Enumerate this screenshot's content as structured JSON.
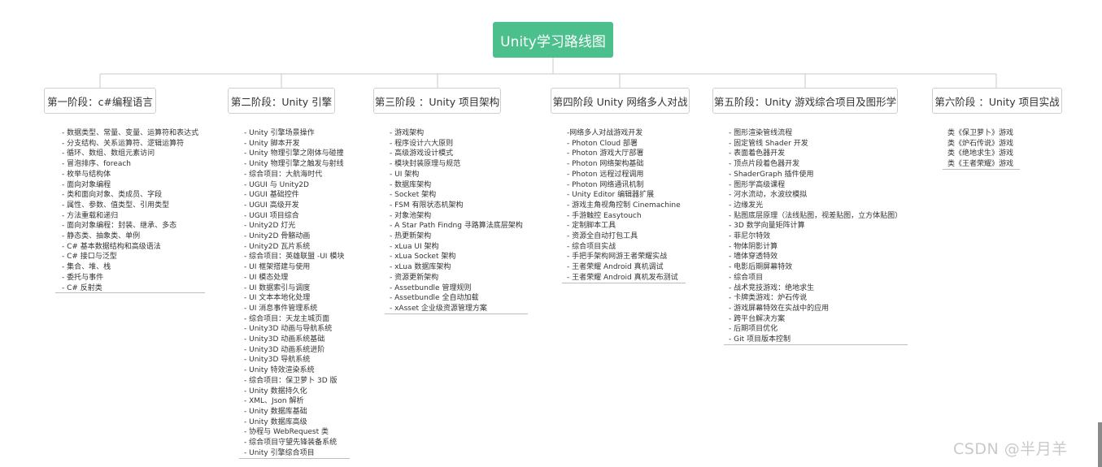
{
  "root": {
    "title": "Unity学习路线图"
  },
  "stages": [
    {
      "title": "第一阶段：c#编程语言",
      "items": [
        "- 数据类型、常量、变量、运算符和表达式",
        "- 分支结构、关系运算符、逻辑运算符",
        "- 循环、数组、数组元素访问",
        "- 冒泡排序、foreach",
        "- 枚举与结构体",
        "- 面向对象编程",
        "- 类和面向对象、类成员、字段",
        "- 属性、参数、值类型、引用类型",
        "- 方法重载和递归",
        "- 面向对象编程：封装、继承、多态",
        "- 静态类、抽象类、单例",
        "- C# 基本数据结构和高级语法",
        "- C# 接口与泛型",
        "- 集合、堆、栈",
        "- 委托与事件",
        "- C# 反射类"
      ]
    },
    {
      "title": "第二阶段：Unity 引擎",
      "items": [
        "- Unity 引擎场景操作",
        "- Unity 脚本开发",
        "- Unity 物理引擎之刚体与碰撞",
        "- Unity 物理引擎之触发与射线",
        "- 综合项目：大航海时代",
        "- UGUI 与 Unity2D",
        "- UGUI 基础控件",
        "- UGUI 高级开发",
        "- UGUI 项目综合",
        "- Unity2D 灯光",
        "- Unity2D 骨骼动画",
        "- Unity2D 瓦片系统",
        "- 综合项目：英雄联盟 -UI 模块",
        "- UI 框架搭建与使用",
        "- UI 模态处理",
        "- UI 数据索引与调度",
        "- UI 文本本地化处理",
        "- UI 消息事件管理系统",
        "- 综合项目：天龙主城页面",
        "- Unity3D 动画与导航系统",
        "- Unity3D 动画系统基础",
        "- Unity3D 动画系统进阶",
        "- Unity3D 导航系统",
        "- Unity 特效渲染系统",
        "- 综合项目：保卫萝卜 3D 版",
        "- Unity 数据持久化",
        "- XML、Json 解析",
        "- Unity 数据库基础",
        "- Unity 数据库高级",
        "- 协程与 WebRequest 类",
        "- 综合项目守望先锋装备系统",
        "- Unity 引擎综合项目"
      ]
    },
    {
      "title": "第三阶段 ：Unity 项目架构",
      "items": [
        "- 游戏架构",
        "- 程序设计六大原则",
        "- 高级游戏设计模式",
        "- 模块封装原理与规范",
        "- UI 架构",
        "- 数据库架构",
        "- Socket 架构",
        "- FSM 有限状态机架构",
        "- 对象池架构",
        "- A Star Path Findng 寻路算法底层架构",
        "- 热更新架构",
        "- xLua UI 架构",
        "- xLua Socket 架构",
        "- xLua 数据库架构",
        "- 资源更新架构",
        "- Assetbundle 管理规则",
        "- Assetbundle 全自动加载",
        "- xAsset 企业级资源管理方案"
      ]
    },
    {
      "title": "第四阶段 Unity 网络多人对战",
      "items": [
        "-网络多人对战游戏开发",
        "- Photon Cloud 部署",
        "- Photon 游戏大厅部署",
        "- Photon 网络架构基础",
        "- Photon 远程过程调用",
        "- Photon 网络通讯机制",
        "- Unity Editor 编辑器扩展",
        "- 游戏主角视角控制 Cinemachine",
        "- 手游触控 Easytouch",
        "- 定制脚本工具",
        "- 资源全自动打包工具",
        "- 综合项目实战",
        "- 手把手架构网游王者荣耀实战",
        "- 王者荣耀 Android 真机调试",
        "- 王者荣耀 Android 真机发布测试"
      ]
    },
    {
      "title": "第五阶段：Unity 游戏综合项目及图形学",
      "items": [
        "- 图形渲染管线流程",
        "- 固定管线 Shader 开发",
        "- 表面着色器开发",
        "- 顶点片段着色器开发",
        "- ShaderGraph 插件使用",
        "- 图形学高级课程",
        "- 河水流动，水波纹模拟",
        "- 边缘发光",
        "- 贴图底层原理（法线贴图，视差贴图，立方体贴图）",
        "- 3D 数学向量矩阵计算",
        "- 菲尼尔特效",
        "- 物体阴影计算",
        "- 墙体穿透特效",
        "- 电影后期屏幕特效",
        "- 综合项目",
        "- 战术竞技游戏：绝地求生",
        "- 卡牌类游戏：炉石传说",
        "- 游戏屏幕特效在实战中的应用",
        "- 跨平台解决方案",
        "- 后期项目优化",
        "- Git 项目版本控制"
      ]
    },
    {
      "title": "第六阶段 ：Unity 项目实战",
      "items": [
        "类《保卫萝卜》游戏",
        "类《炉石传说》游戏",
        "类《绝地求生》游戏",
        "类《王者荣耀》游戏"
      ]
    }
  ],
  "watermark": "CSDN @半月羊",
  "colors": {
    "root_bg": "#4cc08c",
    "border": "#cfcfcf",
    "line": "#bdbdbd"
  }
}
